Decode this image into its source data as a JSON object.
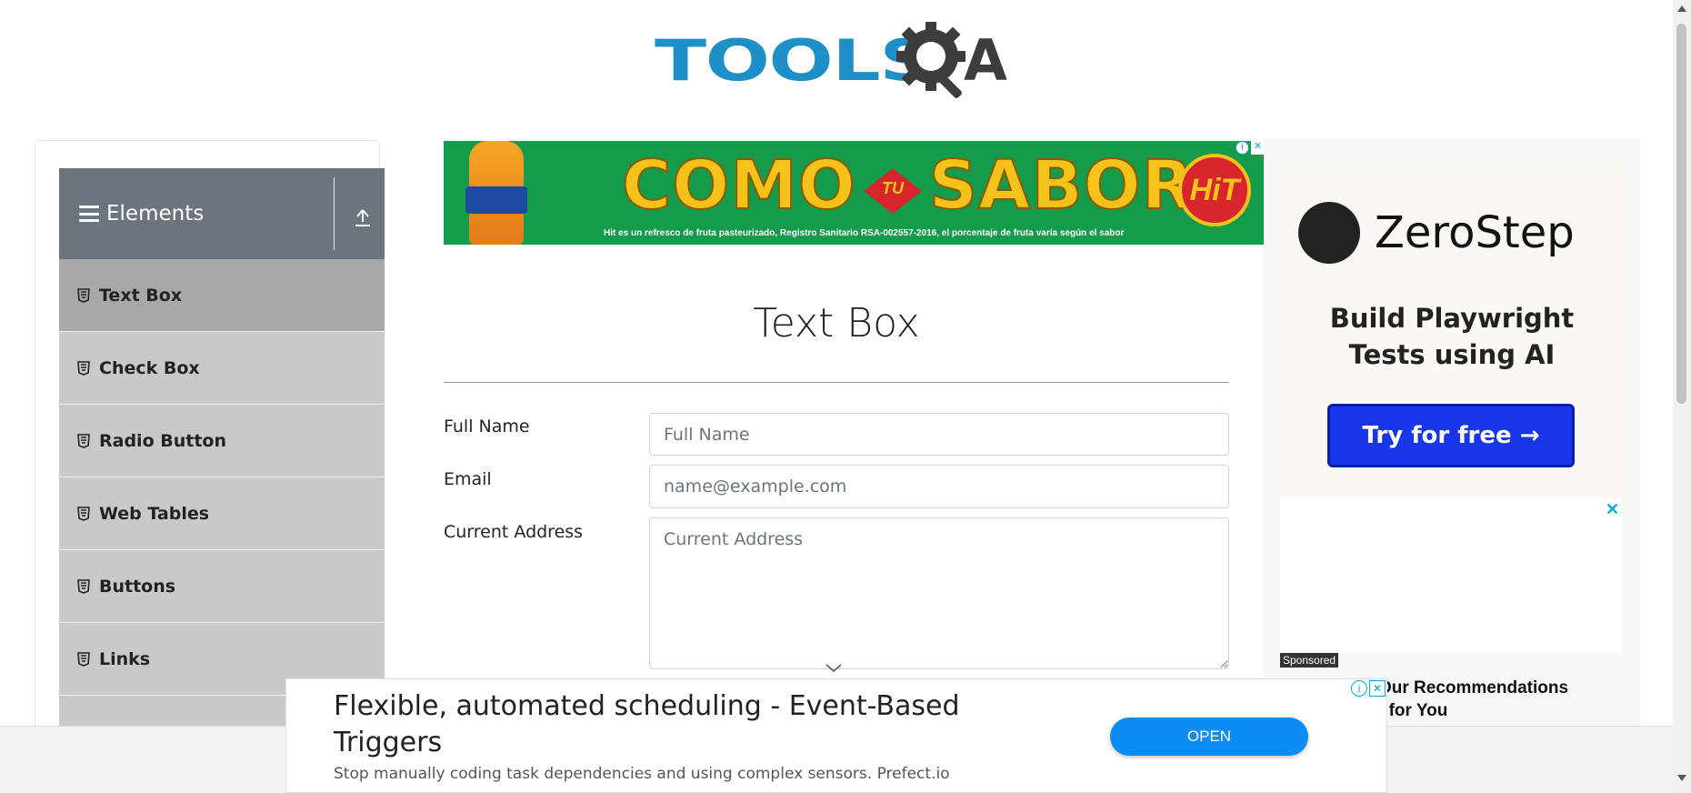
{
  "header": {
    "logo_text": "TOOLS",
    "logo_suffix": "A"
  },
  "sidebar": {
    "group_title": "Elements",
    "items": [
      {
        "label": "Text Box",
        "active": true
      },
      {
        "label": "Check Box"
      },
      {
        "label": "Radio Button"
      },
      {
        "label": "Web Tables"
      },
      {
        "label": "Buttons"
      },
      {
        "label": "Links"
      }
    ]
  },
  "banner_ad": {
    "headline_left": "COMO",
    "headline_mid": "TU",
    "headline_right": "SABOR",
    "brand": "HiT",
    "fine_print": "Hit es un refresco de fruta pasteurizado, Registro Sanitario RSA-002557-2016, el porcentaje de fruta varía según el sabor"
  },
  "main": {
    "title": "Text Box",
    "fields": [
      {
        "label": "Full Name",
        "placeholder": "Full Name",
        "value": ""
      },
      {
        "label": "Email",
        "placeholder": "name@example.com",
        "value": ""
      },
      {
        "label": "Current Address",
        "placeholder": "Current Address",
        "value": ""
      }
    ]
  },
  "right_ad": {
    "brand": "ZeroStep",
    "tagline_1": "Build Playwright",
    "tagline_2": "Tests using AI",
    "cta": "Try for free →",
    "sponsored": "Sponsored",
    "rec_text_1": "Our Recommendations",
    "rec_text_2": "t for You"
  },
  "bottom_ad": {
    "title": "Flexible, automated scheduling - Event-Based Triggers",
    "description": "Stop manually coding task dependencies and using complex sensors. Prefect.io",
    "button": "OPEN"
  },
  "colors": {
    "accent": "#1f8fc8",
    "sidebar_header": "#6c757d",
    "menu_item": "#c9c9c9",
    "menu_active": "#a8a8a8",
    "cta_blue": "#1736e8",
    "open_button": "#0b8cf2"
  }
}
